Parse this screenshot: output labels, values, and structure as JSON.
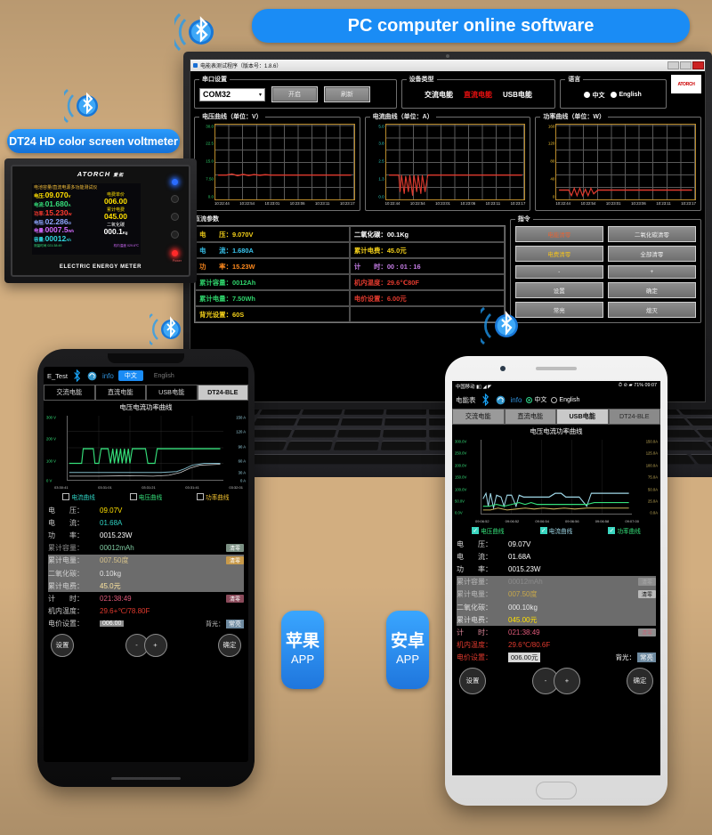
{
  "callouts": {
    "pc_software": "PC computer online software",
    "device": "DT24 HD color screen voltmeter",
    "apple_app": "苹果",
    "apple_app_sub": "APP",
    "android_app": "安卓",
    "android_app_sub": "APP"
  },
  "pc": {
    "window_title": "电能表测试程序（版本号：1.8.6）",
    "groups": {
      "serial": "串口设置",
      "device_type": "设备类型",
      "language": "语言",
      "command": "指令"
    },
    "serial": {
      "port": "COM32",
      "open": "开启",
      "refresh": "刷新"
    },
    "device_types": [
      {
        "label": "交流电能",
        "active": false
      },
      {
        "label": "直流电能",
        "active": true
      },
      {
        "label": "USB电能",
        "active": false
      }
    ],
    "languages": [
      {
        "label": "中文",
        "selected": true
      },
      {
        "label": "English",
        "selected": false
      }
    ],
    "brand": "ATORCH",
    "charts": [
      {
        "title": "电压曲线（单位：V）",
        "yticks": [
          "30.0",
          "22.5",
          "15.0",
          "7.50",
          "0.0"
        ],
        "color": "#2fd36b"
      },
      {
        "title": "电流曲线（单位：A）",
        "yticks": [
          "5.0",
          "3.8",
          "2.5",
          "1.3",
          "0.0"
        ],
        "color": "#2fd3c4"
      },
      {
        "title": "功率曲线（单位：W）",
        "yticks": [
          "160",
          "120",
          "80",
          "40",
          "0"
        ],
        "color": "#f2c230"
      }
    ],
    "xticks": [
      "10:22:44",
      "10:22:54",
      "10:23:01",
      "10:23:06",
      "10:23:11",
      "10:23:17"
    ],
    "params": [
      {
        "label": "电　　压：",
        "value": "9.070V",
        "color": "#f5d11a",
        "col": "l"
      },
      {
        "label": "二氧化碳：",
        "value": "00.1Kg",
        "color": "#ffffff",
        "col": "r"
      },
      {
        "label": "电　　流：",
        "value": "1.680A",
        "color": "#39c6f0",
        "col": "l"
      },
      {
        "label": "累计电费：",
        "value": "45.0元",
        "color": "#f5d11a",
        "col": "r"
      },
      {
        "label": "功　　率：",
        "value": "15.23W",
        "color": "#ff8a1e",
        "col": "l"
      },
      {
        "label": "计　　时：",
        "value": "00 : 01 : 16",
        "color": "#c77ee8",
        "col": "r"
      },
      {
        "label": "累计容量：",
        "value": "0012Ah",
        "color": "#2fd36b",
        "col": "l"
      },
      {
        "label": "机内温度：",
        "value": "29.6℃80F",
        "color": "#e23a2e",
        "col": "r"
      },
      {
        "label": "累计电量：",
        "value": "7.50Wh",
        "color": "#2fd36b",
        "col": "l"
      },
      {
        "label": "电价设置：",
        "value": "6.00元",
        "color": "#e23a2e",
        "col": "r"
      },
      {
        "label": "背光设置：",
        "value": "60S",
        "color": "#f5d11a",
        "col": "l"
      },
      {
        "label": "",
        "value": "",
        "color": "#fff",
        "col": "r"
      }
    ],
    "commands": [
      {
        "label": "电能清零",
        "color": "#e0663a"
      },
      {
        "label": "二氧化碳清零",
        "color": "#ffffff"
      },
      {
        "label": "电费清零",
        "color": "#f0c020"
      },
      {
        "label": "全部清零",
        "color": "#ffffff"
      },
      {
        "label": "-",
        "color": "#ffffff"
      },
      {
        "label": "+",
        "color": "#ffffff"
      },
      {
        "label": "设置",
        "color": "#ffffff"
      },
      {
        "label": "确定",
        "color": "#ffffff"
      },
      {
        "label": "常亮",
        "color": "#ffffff"
      },
      {
        "label": "熄灭",
        "color": "#ffffff"
      }
    ]
  },
  "device": {
    "brand": "ATORCH",
    "brand_cn": "爱拓",
    "subtitle": "电池容量/直流电源多功能测试仪",
    "footer": "ELECTRIC ENERGY METER",
    "left_rows": [
      {
        "label": "电压:",
        "value": "09.070",
        "unit": "V",
        "color": "#ffe000"
      },
      {
        "label": "电流:",
        "value": "01.680",
        "unit": "A",
        "color": "#35e07a"
      },
      {
        "label": "功率:",
        "value": "15.230",
        "unit": "W",
        "color": "#ff3b30"
      },
      {
        "label": "电阻:",
        "value": "02.286",
        "unit": "Ω",
        "color": "#8fa6ff"
      },
      {
        "label": "电量:",
        "value": "0007.5",
        "unit": "Wh",
        "color": "#d46bff"
      },
      {
        "label": "容量:",
        "value": "00012",
        "unit": "Ah",
        "color": "#2fd8e0"
      }
    ],
    "right_rows": [
      {
        "label": "电费单价",
        "value": "006.00",
        "unit": "",
        "color": "#ffe000"
      },
      {
        "label": "累计电费",
        "value": "045.00",
        "unit": "",
        "color": "#ffe000"
      },
      {
        "label": "二氧化碳",
        "value": "000.1",
        "unit": "Kg",
        "color": "#ffffff"
      }
    ],
    "foot_left": "测量时间 021:38:49",
    "foot_right": "机内温度 029.6℃",
    "power_label": "Power"
  },
  "apple_app": {
    "topbar": {
      "name": "E_Test",
      "info": "info",
      "lang_cn": "中文",
      "lang_en": "English"
    },
    "tabs": [
      {
        "label": "交流电能",
        "selected": false
      },
      {
        "label": "直流电能",
        "selected": false
      },
      {
        "label": "USB电能",
        "selected": false
      },
      {
        "label": "DT24-BLE",
        "selected": true
      }
    ],
    "chart_title": "电压电流功率曲线",
    "legend": [
      {
        "label": "电流曲线",
        "color": "#2fd3c4",
        "checked": true
      },
      {
        "label": "电压曲线",
        "color": "#35e07a",
        "checked": true
      },
      {
        "label": "功率曲线",
        "color": "#f2c230",
        "checked": true
      }
    ],
    "readout": [
      {
        "label": "电　　压：",
        "value": "09.07V",
        "color": "#ffe000",
        "btn": ""
      },
      {
        "label": "电　　流：",
        "value": "01.68A",
        "color": "#2fd3c4",
        "btn": ""
      },
      {
        "label": "功　　率：",
        "value": "0015.23W",
        "color": "#ffffff",
        "btn": ""
      },
      {
        "label": "累计容量：",
        "value": "00012mAh",
        "color": "#7fc9a0",
        "btn": "清零"
      },
      {
        "label": "累计电量：",
        "value": "007.50度",
        "color": "#d6c28a",
        "btn": "清零"
      },
      {
        "label": "二氧化碳：",
        "value": "0.10kg",
        "color": "#e2e2e2",
        "btn": ""
      },
      {
        "label": "累计电费：",
        "value": "45.0元",
        "color": "#ffe6a0",
        "btn": ""
      },
      {
        "label": "计　　时：",
        "value": "021:38:49",
        "color": "#e05a7a",
        "btn": "清零"
      },
      {
        "label": "机内温度：",
        "value": "29.6+℃/78.80F",
        "color": "#e23a2e",
        "btn": ""
      }
    ],
    "price_label": "电价设置：",
    "price_value": "006.00",
    "backlight_label": "背光：",
    "backlight_value": "常亮",
    "buttons": {
      "set": "设置",
      "minus": "-",
      "plus": "+",
      "ok": "确定"
    }
  },
  "android_app": {
    "statusbar": {
      "carrier": "中国移动",
      "battery": "71%",
      "time": "09:07"
    },
    "topbar": {
      "name": "电能表",
      "info": "info",
      "lang_cn": "中文",
      "lang_en": "English"
    },
    "tabs": [
      {
        "label": "交流电能",
        "selected": false
      },
      {
        "label": "直流电能",
        "selected": false
      },
      {
        "label": "USB电能",
        "selected": true
      },
      {
        "label": "DT24-BLE",
        "selected": false
      }
    ],
    "chart_title": "电压电流功率曲线",
    "yleft": [
      "300.0V",
      "250.0V",
      "200.0V",
      "150.0V",
      "100.0V",
      "50.0V",
      "0.0V"
    ],
    "yright": [
      "150.0A",
      "125.0A",
      "100.0A",
      "75.0A",
      "50.0A",
      "25.0A",
      "0.0A"
    ],
    "xticks": [
      "09:06:52",
      "09:06:52",
      "09:06:54",
      "09:06:56",
      "09:06:58",
      "09:07:00"
    ],
    "legend": [
      {
        "label": "电压曲线",
        "color": "#35e07a",
        "checked": true
      },
      {
        "label": "电流曲线",
        "color": "#9fd8e8",
        "checked": true
      },
      {
        "label": "功率曲线",
        "color": "#35e07a",
        "checked": true
      }
    ],
    "readout": [
      {
        "label": "电　　压：",
        "value": "09.07V",
        "color": "#ffffff",
        "btn": ""
      },
      {
        "label": "电　　流：",
        "value": "01.68A",
        "color": "#ffffff",
        "btn": ""
      },
      {
        "label": "功　　率：",
        "value": "0015.23W",
        "color": "#ffffff",
        "btn": ""
      },
      {
        "label": "累计容量：",
        "value": "00012mAh",
        "color": "#8a8a8a",
        "btn": "清零"
      },
      {
        "label": "累计电量：",
        "value": "007.50度",
        "color": "#c8a84a",
        "btn": "清零"
      },
      {
        "label": "二氧化碳：",
        "value": "000.10kg",
        "color": "#e8e8e8",
        "btn": ""
      },
      {
        "label": "累计电费：",
        "value": "045.00元",
        "color": "#ffe000",
        "btn": ""
      },
      {
        "label": "计　　时：",
        "value": "021:38:49",
        "color": "#e05a7a",
        "btn": "清零"
      },
      {
        "label": "机内温度：",
        "value": "29.6℃/80.6F",
        "color": "#e23a2e",
        "btn": ""
      }
    ],
    "price_label": "电价设置：",
    "price_value": "006.00元",
    "backlight_label": "背光：",
    "backlight_value": "常亮",
    "buttons": {
      "set": "设置",
      "minus": "-",
      "plus": "+",
      "ok": "确定"
    }
  },
  "icons": {
    "bluetooth": "bluetooth-icon",
    "refresh": "refresh-icon",
    "wifi": "wifi-icon",
    "signal": "signal-icon"
  }
}
